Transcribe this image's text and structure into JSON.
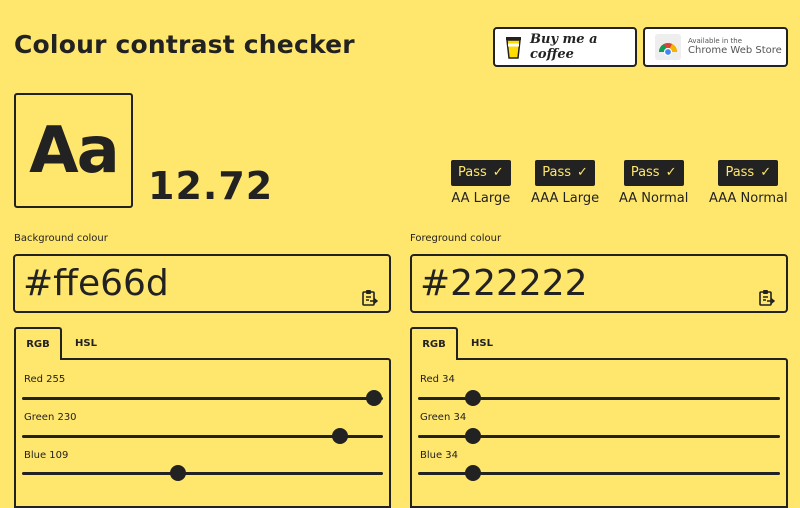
{
  "header": {
    "title": "Colour contrast checker"
  },
  "buttons": {
    "coffee_label": "Buy me a coffee",
    "cws_line1": "Available in the",
    "cws_line2": "Chrome Web Store"
  },
  "preview": {
    "sample_text": "Aa",
    "ratio": "12.72"
  },
  "results": [
    {
      "status": "Pass",
      "label": "AA Large"
    },
    {
      "status": "Pass",
      "label": "AAA Large"
    },
    {
      "status": "Pass",
      "label": "AA Normal"
    },
    {
      "status": "Pass",
      "label": "AAA Normal"
    }
  ],
  "background": {
    "label": "Background colour",
    "hex": "#ffe66d",
    "tabs": [
      "RGB",
      "HSL"
    ],
    "active_tab": "RGB",
    "sliders": [
      {
        "label": "Red 255",
        "value": 255,
        "max": 255
      },
      {
        "label": "Green 230",
        "value": 230,
        "max": 255
      },
      {
        "label": "Blue 109",
        "value": 109,
        "max": 255
      }
    ]
  },
  "foreground": {
    "label": "Foreground colour",
    "hex": "#222222",
    "tabs": [
      "RGB",
      "HSL"
    ],
    "active_tab": "RGB",
    "sliders": [
      {
        "label": "Red 34",
        "value": 34,
        "max": 255
      },
      {
        "label": "Green 34",
        "value": 34,
        "max": 255
      },
      {
        "label": "Blue 34",
        "value": 34,
        "max": 255
      }
    ]
  },
  "colors": {
    "background": "#ffe66d",
    "foreground": "#222222",
    "coffee_cup": "#ffdd00"
  },
  "icons": {
    "check": "check-icon",
    "clipboard": "clipboard-icon",
    "cup": "coffee-cup-icon",
    "chrome": "chrome-logo-icon"
  }
}
